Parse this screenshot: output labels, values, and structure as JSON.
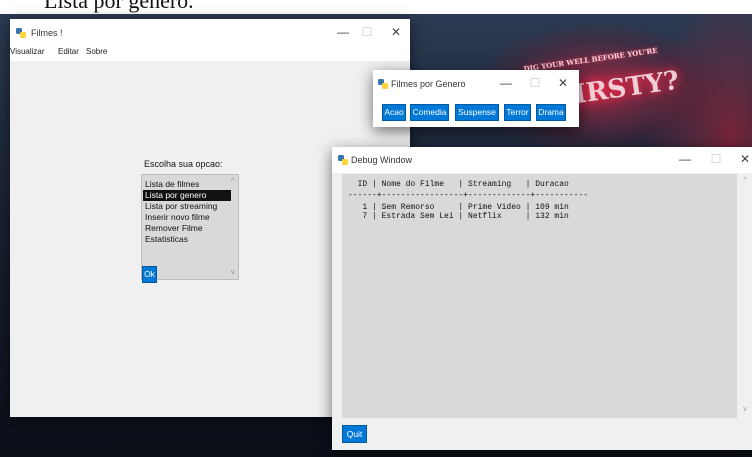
{
  "doc_heading": "Lista por genero.",
  "main_window": {
    "title": "Filmes !",
    "menu": [
      "Visualizar",
      "Editar",
      "Sobre"
    ],
    "prompt": "Escolha sua opcao:",
    "options": [
      "Lista de filmes",
      "Lista por genero",
      "Lista por streaming",
      "Inserir novo filme",
      "Remover Filme",
      "Estatisticas"
    ],
    "selected_index": 1,
    "ok_label": "Ok"
  },
  "genre_window": {
    "title": "Filmes por Genero",
    "buttons": [
      "Acao",
      "Comedia",
      "Suspense",
      "Terror",
      "Drama"
    ]
  },
  "debug_window": {
    "title": "Debug Window",
    "lines": [
      "  ID | Nome do Filme   | Streaming   | Duracao",
      "------+-----------------+-------------+-----------",
      "   1 | Sem Remorso     | Prime Video | 109 min",
      "   7 | Estrada Sem Lei | Netflix     | 132 min"
    ],
    "quit_label": "Quit"
  },
  "wallpaper": {
    "line1": "DIG YOUR WELL BEFORE YOU'RE",
    "line2": "THIRSTY?"
  },
  "window_controls": {
    "minimize": "—",
    "maximize": "☐",
    "close": "✕"
  },
  "icon_names": [
    "python-icon",
    "minimize-icon",
    "maximize-icon",
    "close-icon",
    "scroll-up-arrow-icon",
    "scroll-down-arrow-icon"
  ],
  "colors": {
    "button_blue": "#0078d7",
    "selected_bg": "#111111",
    "list_bg": "#d9d9d9",
    "window_bg": "#f0f0f0"
  }
}
